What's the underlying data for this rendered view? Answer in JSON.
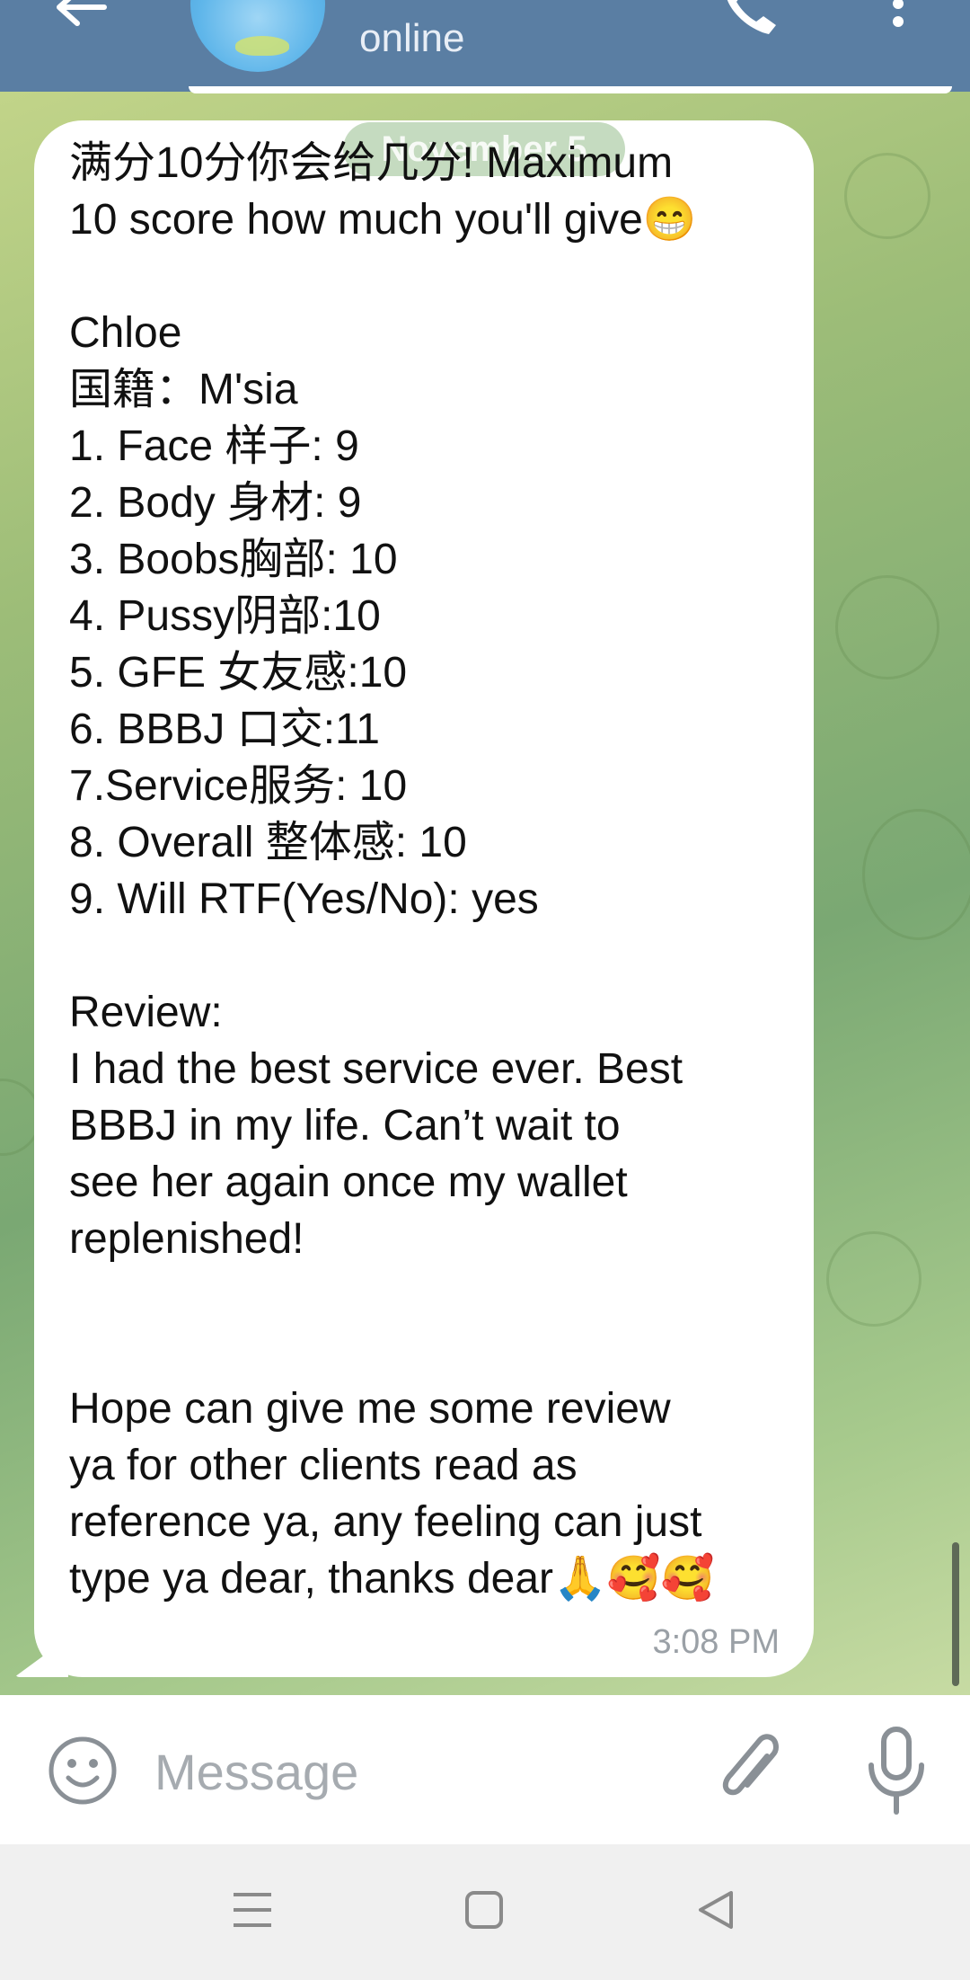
{
  "header": {
    "status": "online"
  },
  "date_chip": "November 5",
  "message": {
    "text": "满分10分你会给几分! Maximum\n10 score how much you'll give😁\n\nChloe\n国籍：M'sia\n1. Face 样子: 9\n2. Body 身材: 9\n3. Boobs胸部: 10\n4. Pussy阴部:10\n5. GFE 女友感:10\n6. BBBJ 口交:11\n7.Service服务: 10\n8. Overall 整体感: 10\n9. Will RTF(Yes/No): yes\n\nReview:\nI had the best service ever. Best\nBBBJ in my life. Can’t wait to\nsee her again once my wallet\nreplenished!\n\n\nHope can give me some review\nya for other clients read as\nreference ya, any feeling can just\ntype ya dear, thanks dear🙏🥰🥰",
    "time": "3:08 PM"
  },
  "composer": {
    "placeholder": "Message"
  },
  "icons": {
    "back": "arrow-left-icon",
    "call": "phone-icon",
    "more": "more-vertical-icon",
    "emoji": "smiley-icon",
    "attach": "paperclip-icon",
    "mic": "microphone-icon",
    "nav_recents": "recents-icon",
    "nav_home": "home-icon",
    "nav_back": "nav-back-icon"
  },
  "colors": {
    "header_bg": "#5a7ea3",
    "bubble_bg": "#ffffff",
    "time_text": "#9aa0a6"
  }
}
